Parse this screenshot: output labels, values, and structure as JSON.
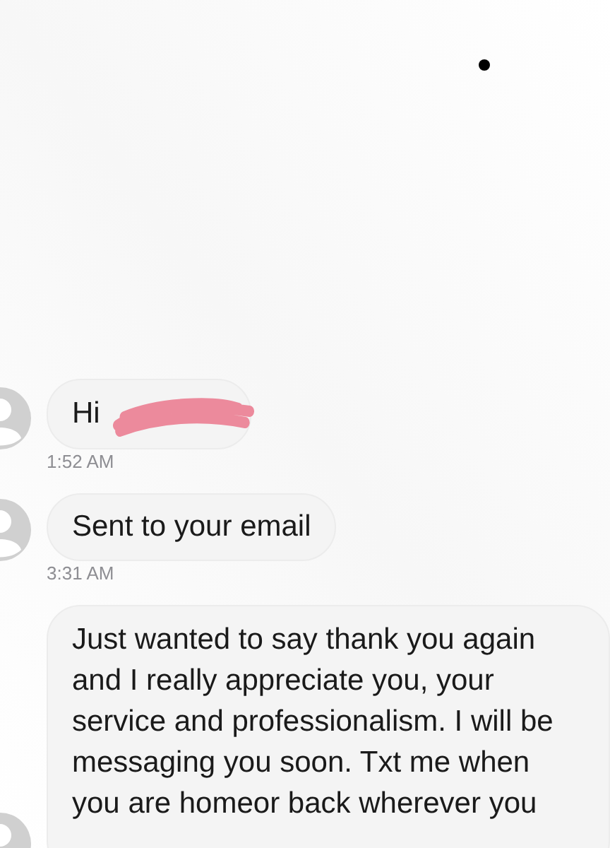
{
  "messages": [
    {
      "text": "Hi",
      "redacted": true,
      "time": "1:52 AM"
    },
    {
      "text": "Sent to your email",
      "time": "3:31 AM"
    },
    {
      "text": "Just wanted to say thank you again and I really appreciate you, your service and professionalism. I will be messaging you soon. Txt me when you are homeor back wherever you"
    }
  ]
}
